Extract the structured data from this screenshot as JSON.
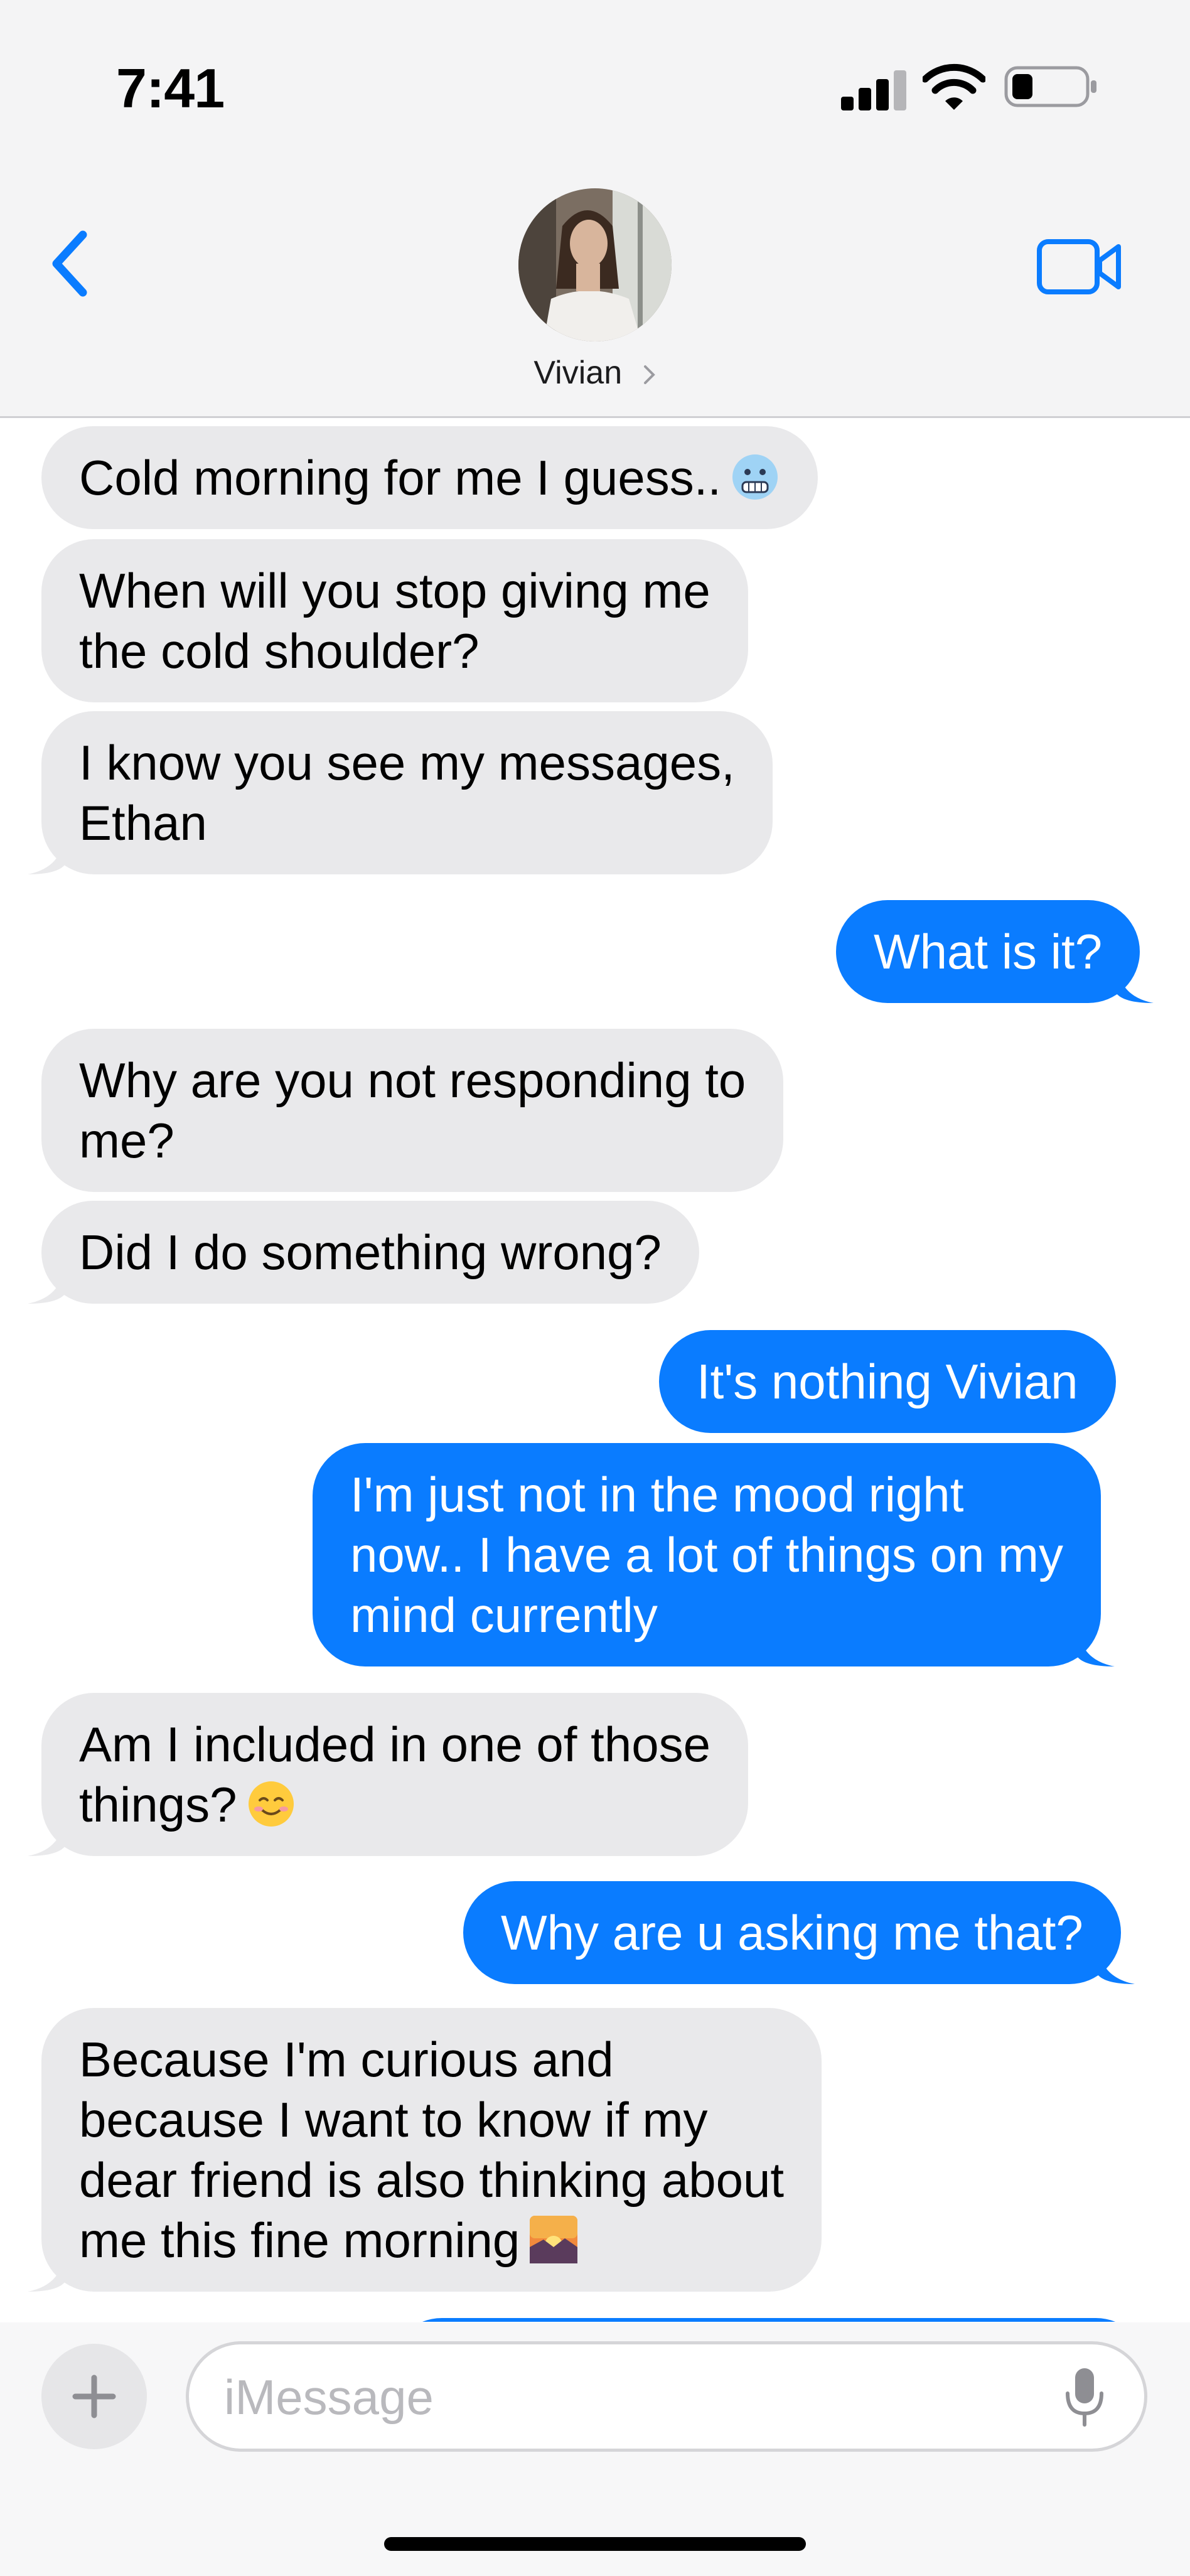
{
  "status_bar": {
    "time": "7:41",
    "icons": [
      "cellular-signal-icon",
      "wifi-icon",
      "battery-low-icon"
    ]
  },
  "header": {
    "back_icon": "chevron-left-icon",
    "contact_name": "Vivian",
    "contact_chevron_icon": "chevron-right-icon",
    "video_icon": "video-camera-icon"
  },
  "messages": [
    {
      "direction": "incoming",
      "lines": [
        "Cold morning for me I guess.."
      ],
      "emoji": "cold-face-emoji"
    },
    {
      "direction": "incoming",
      "lines": [
        "When will you stop giving me",
        "the cold shoulder?"
      ]
    },
    {
      "direction": "incoming",
      "lines": [
        "I know you see my messages,",
        "Ethan"
      ]
    },
    {
      "direction": "outgoing",
      "lines": [
        "What is it?"
      ]
    },
    {
      "direction": "incoming",
      "lines": [
        "Why are you not responding to",
        "me?"
      ]
    },
    {
      "direction": "incoming",
      "lines": [
        "Did I do something wrong?"
      ]
    },
    {
      "direction": "outgoing",
      "lines": [
        "It's nothing Vivian"
      ]
    },
    {
      "direction": "outgoing",
      "lines": [
        "I'm just not in the mood right",
        "now.. I have a lot of things on my",
        "mind currently"
      ]
    },
    {
      "direction": "incoming",
      "lines": [
        "Am I included in one of those",
        "things?"
      ],
      "emoji": "smiling-face-emoji"
    },
    {
      "direction": "outgoing",
      "lines": [
        "Why are u asking me that?"
      ]
    },
    {
      "direction": "incoming",
      "lines": [
        "Because I'm curious and",
        "because I want to know if my",
        "dear friend is also thinking about",
        "me this fine morning"
      ],
      "emoji": "sunrise-emoji"
    }
  ],
  "composer": {
    "plus_icon": "plus-icon",
    "placeholder": "iMessage",
    "mic_icon": "microphone-icon"
  },
  "colors": {
    "accent": "#0a7cff",
    "incoming_bubble": "#e9e9eb",
    "header_bg": "#f4f4f5"
  }
}
